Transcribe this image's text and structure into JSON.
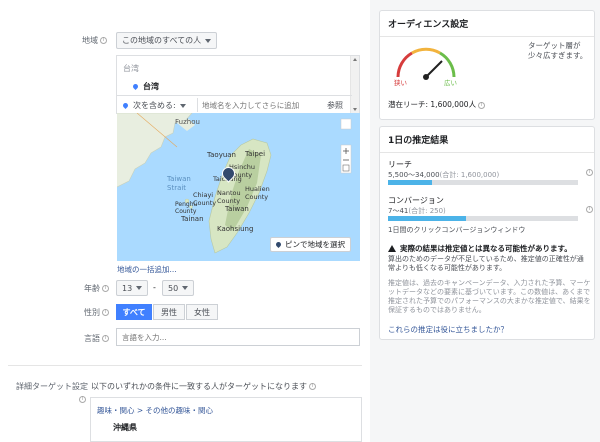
{
  "location": {
    "label": "地域",
    "dropdown_value": "この地域のすべての人",
    "country_header": "台湾",
    "selected_place": "台湾",
    "include_label": "次を含める:",
    "search_placeholder": "地域名を入力してさらに追加",
    "browse_label": "参照",
    "pin_button": "ピンで地域を選択",
    "bulk_link": "地域の一括追加...",
    "map_labels": [
      "Fuzhou",
      "Taoyuan",
      "Taipei",
      "Hsinchu County",
      "Taiwan Strait",
      "Taiwan",
      "Taichung",
      "Nantou County",
      "Hualien County",
      "Chiayi County",
      "Tainan",
      "Kaohsiung",
      "Penghu County"
    ]
  },
  "age": {
    "label": "年齢",
    "min": "13",
    "max": "50",
    "dash": "-"
  },
  "gender": {
    "label": "性別",
    "options": [
      "すべて",
      "男性",
      "女性"
    ],
    "selected": "すべて"
  },
  "language": {
    "label": "言語",
    "placeholder": "言語を入力..."
  },
  "detailed": {
    "label": "詳細ターゲット設定",
    "description": "以下のいずれかの条件に一致する人がターゲットになります",
    "breadcrumb": "趣味・関心 > その他の趣味・関心",
    "item": "沖縄県"
  },
  "audience": {
    "title": "オーディエンス設定",
    "gauge_narrow": "狭い",
    "gauge_wide": "広い",
    "description": "ターゲット層が少々広すぎます。",
    "reach_label": "潜在リーチ: 1,600,000人"
  },
  "estimates": {
    "title": "1日の推定結果",
    "reach_title": "リーチ",
    "reach_value": "5,500〜34,000",
    "reach_total": "(合計: 1,600,000)",
    "reach_fill": 0.23,
    "conv_title": "コンバージョン",
    "conv_value": "7〜41",
    "conv_total": "(合計: 250)",
    "conv_fill": 0.41,
    "conv_window": "1日間のクリックコンバージョンウィンドウ",
    "warning_title": "実際の結果は推定値とは異なる可能性があります。",
    "warning_body": "算出のためのデータが不足しているため、推定値の正確性が通常よりも低くなる可能性があります。",
    "note_body": "推定値は、過去のキャンペーンデータ、入力された予算、マーケットデータなどの要素に基づいています。この数値は、あくまで推定された予算でのパフォーマンスの大まかな推定値で、結果を保証するものではありません。",
    "feedback_link": "これらの推定は役に立ちましたか？"
  },
  "colors": {
    "accent": "#4080ff",
    "bar": "#4cb3e8",
    "link": "#365899"
  }
}
